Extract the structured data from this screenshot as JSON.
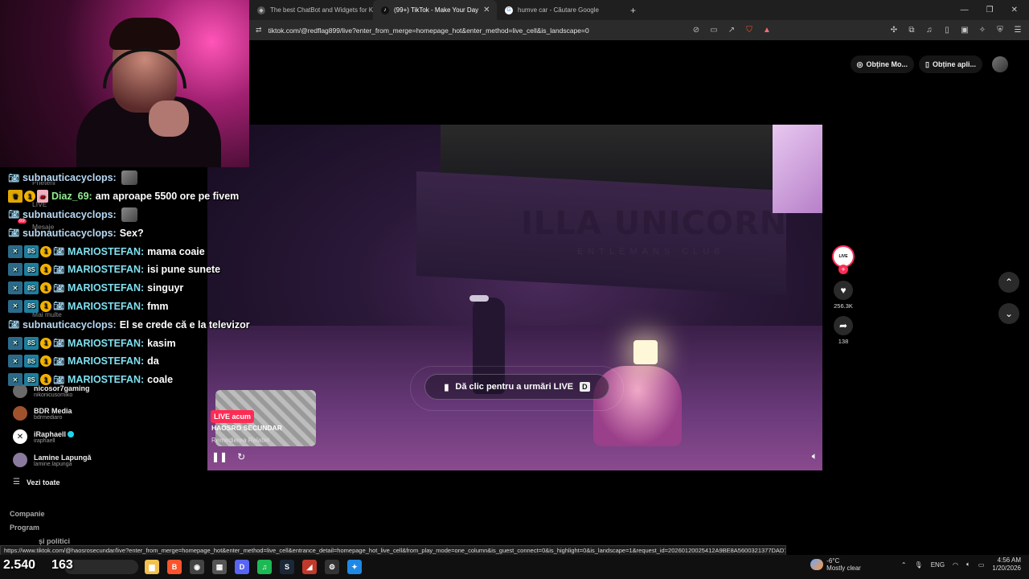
{
  "browser": {
    "tabs": [
      {
        "title": "The best ChatBot and Widgets for K",
        "active": false
      },
      {
        "title": "(99+) TikTok - Make Your Day",
        "active": true
      },
      {
        "title": "humve car - Căutare Google",
        "active": false
      }
    ],
    "url": "tiktok.com/@redflag899/live?enter_from_merge=homepage_hot&enter_method=live_cell&is_landscape=0",
    "status_url": "https://www.tiktok.com/@haosrosecundar/live?enter_from_merge=homepage_hot&enter_method=live_cell&entrance_detail=homepage_hot_live_cell&from_play_mode=one_column&is_guest_connect=0&is_highlight=0&is_landscape=1&request_id=20260120025412A9BE8A5600321377DAD7"
  },
  "page": {
    "get_coins_label": "Obține Mo...",
    "get_app_label": "Obține apli...",
    "cta_label": "Dă clic pentru a urmări LIVE",
    "cta_key": "D",
    "sign_text": "ILLA UNICORN",
    "sign_sub": "ENTLEMANS CLUB",
    "thumb": {
      "badge": "LIVE acum",
      "title": "HAOSRO SECUNDAR",
      "subtitle": "Remedierea Relatiei"
    },
    "rail": {
      "live_badge": "LIVE",
      "likes": "256.3K",
      "shares": "138"
    }
  },
  "sidebar": {
    "users": [
      {
        "name": "nicosor7gaming",
        "handle": "nikonicusorniko",
        "color": "#6a6a6a"
      },
      {
        "name": "BDR Media",
        "handle": "bdrmediaro",
        "color": "#a0522d"
      },
      {
        "name": "iRaphaell",
        "handle": "iraphaell",
        "color": "#ffffff",
        "verified": true
      },
      {
        "name": "Lamine Lapungă",
        "handle": "lamine.lapunga",
        "color": "#8a7aa0"
      }
    ],
    "see_all": "Vezi toate",
    "company": "Companie",
    "program": "Program",
    "policies": "și politici",
    "ghost_friends": "Prieteni",
    "ghost_live": "LIVE",
    "ghost_messages": "Mesaje",
    "ghost_more": "Mai multe",
    "ghost_notif": "69"
  },
  "chat": [
    {
      "badges": [
        "cam2"
      ],
      "user": "subnauticacyclops:",
      "ucls": "uname-a",
      "msg": "",
      "emote": true
    },
    {
      "badges": [
        "vip",
        "num",
        "gift"
      ],
      "user": "Diaz_69:",
      "ucls": "uname-c",
      "msg": "am aproape 5500 ore pe fivem"
    },
    {
      "badges": [
        "cam2"
      ],
      "user": "subnauticacyclops:",
      "ucls": "uname-a",
      "msg": "",
      "emote": true
    },
    {
      "badges": [
        "cam2"
      ],
      "user": "subnauticacyclops:",
      "ucls": "uname-a",
      "msg": "Sex?"
    },
    {
      "badges": [
        "cam",
        "sub",
        "num",
        "cam2"
      ],
      "user": "MARIOSTEFAN:",
      "ucls": "uname-b",
      "msg": "mama coaie"
    },
    {
      "badges": [
        "cam",
        "sub",
        "num",
        "cam2"
      ],
      "user": "MARIOSTEFAN:",
      "ucls": "uname-b",
      "msg": "isi pune sunete"
    },
    {
      "badges": [
        "cam",
        "sub",
        "num",
        "cam2"
      ],
      "user": "MARIOSTEFAN:",
      "ucls": "uname-b",
      "msg": "singuyr"
    },
    {
      "badges": [
        "cam",
        "sub",
        "num",
        "cam2"
      ],
      "user": "MARIOSTEFAN:",
      "ucls": "uname-b",
      "msg": "fmm"
    },
    {
      "badges": [
        "cam2"
      ],
      "user": "subnauticacyclops:",
      "ucls": "uname-a",
      "msg": "El se crede că e la televizor"
    },
    {
      "badges": [
        "cam",
        "sub",
        "num",
        "cam2"
      ],
      "user": "MARIOSTEFAN:",
      "ucls": "uname-b",
      "msg": "kasim"
    },
    {
      "badges": [
        "cam",
        "sub",
        "num",
        "cam2"
      ],
      "user": "MARIOSTEFAN:",
      "ucls": "uname-b",
      "msg": "da"
    },
    {
      "badges": [
        "cam",
        "sub",
        "num",
        "cam2"
      ],
      "user": "MARIOSTEFAN:",
      "ucls": "uname-b",
      "msg": "coale"
    }
  ],
  "overlay_stats": {
    "viewers": "2.540",
    "followers": "163"
  },
  "taskbar": {
    "apps": [
      {
        "name": "file-explorer-icon",
        "color": "#f2c14e",
        "glyph": "▆"
      },
      {
        "name": "brave-icon",
        "color": "#fb542b",
        "glyph": "B"
      },
      {
        "name": "obs-icon",
        "color": "#444",
        "glyph": "◉"
      },
      {
        "name": "store-icon",
        "color": "#555",
        "glyph": "▦"
      },
      {
        "name": "discord-icon",
        "color": "#5865f2",
        "glyph": "D"
      },
      {
        "name": "spotify-icon",
        "color": "#1db954",
        "glyph": "♫"
      },
      {
        "name": "steam-icon",
        "color": "#1b2838",
        "glyph": "S"
      },
      {
        "name": "app-red-icon",
        "color": "#c0392b",
        "glyph": "◢"
      },
      {
        "name": "settings-app-icon",
        "color": "#333",
        "glyph": "⚙"
      },
      {
        "name": "vpn-icon",
        "color": "#1e88e5",
        "glyph": "✦"
      }
    ],
    "weather_temp": "-6°C",
    "weather_desc": "Mostly clear",
    "lang": "ENG",
    "time": "4:56 AM",
    "date": "1/20/2026"
  }
}
